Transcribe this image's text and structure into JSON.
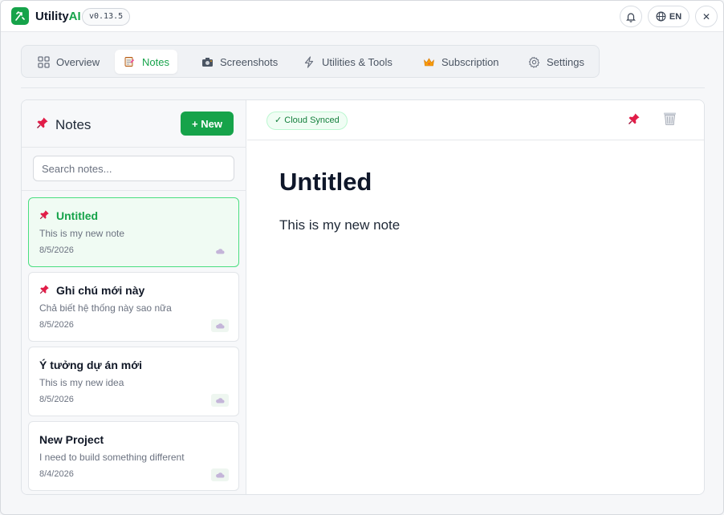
{
  "app": {
    "name_main": "Utility",
    "name_accent": "AI",
    "version": "v0.13.5",
    "language": "EN",
    "close_glyph": "✕"
  },
  "tabs": [
    {
      "label": "Overview",
      "icon": "grid-icon",
      "active": false
    },
    {
      "label": "Notes",
      "icon": "memo-icon",
      "active": true
    },
    {
      "label": "Screenshots",
      "icon": "camera-icon",
      "active": false
    },
    {
      "label": "Utilities & Tools",
      "icon": "lightning-icon",
      "active": false
    },
    {
      "label": "Subscription",
      "icon": "crown-icon",
      "active": false
    },
    {
      "label": "Settings",
      "icon": "gear-icon",
      "active": false
    }
  ],
  "sidebar": {
    "title": "Notes",
    "new_button": "+ New",
    "search_placeholder": "Search notes...",
    "notes": [
      {
        "title": "Untitled",
        "preview": "This is my new note",
        "date": "8/5/2026",
        "pinned": true,
        "selected": true
      },
      {
        "title": "Ghi chú mới này",
        "preview": "Chả biết hệ thống này sao nữa",
        "date": "8/5/2026",
        "pinned": true,
        "selected": false
      },
      {
        "title": "Ý tưởng dự án mới",
        "preview": "This is my new idea",
        "date": "8/5/2026",
        "pinned": false,
        "selected": false
      },
      {
        "title": "New Project",
        "preview": "I need to build something different",
        "date": "8/4/2026",
        "pinned": false,
        "selected": false
      }
    ]
  },
  "editor": {
    "sync_status": "✓ Cloud Synced",
    "title": "Untitled",
    "body": "This is my new note"
  },
  "colors": {
    "accent": "#16a34a",
    "pin": "#e11d48"
  }
}
